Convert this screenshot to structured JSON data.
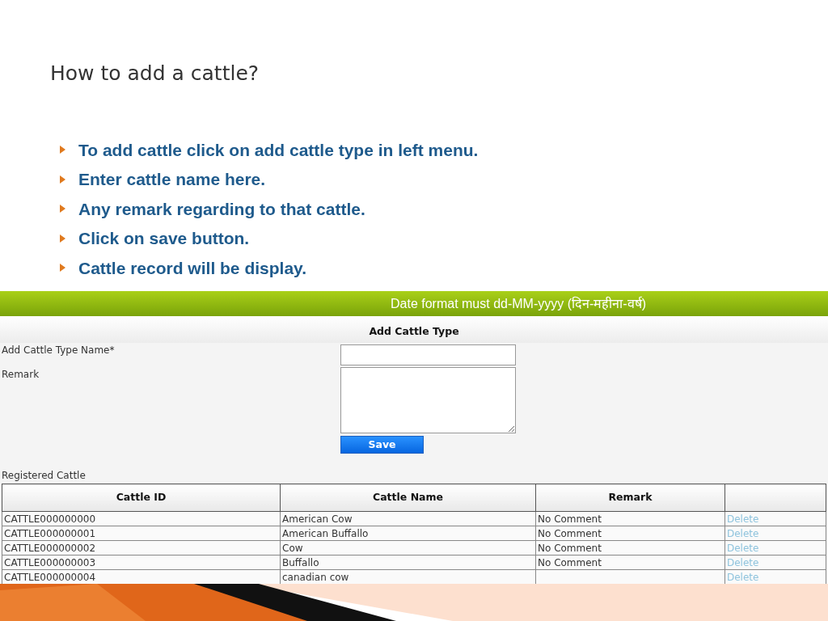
{
  "slide_title": "How to add a cattle?",
  "bullets": [
    "To add cattle click on add cattle type in left menu.",
    "Enter cattle name here.",
    "Any remark regarding to that cattle.",
    "Click on save button.",
    "Cattle record will be display."
  ],
  "app": {
    "banner": "Date format must dd-MM-yyyy (दिन-महीना-वर्ष)",
    "form_title": "Add Cattle Type",
    "fields": [
      {
        "kind": "input",
        "label": "Add Cattle Type Name*"
      },
      {
        "kind": "textarea",
        "label": "Remark"
      }
    ],
    "save_button": "Save",
    "table_caption": "Registered Cattle",
    "table": {
      "columns": [
        "Cattle ID",
        "Cattle Name",
        "Remark"
      ],
      "rows": [
        {
          "id": "CATTLE000000000",
          "name": "American Cow",
          "remark": "No Comment",
          "action": "Delete"
        },
        {
          "id": "CATTLE000000001",
          "name": "American Buffallo",
          "remark": "No Comment",
          "action": "Delete"
        },
        {
          "id": "CATTLE000000002",
          "name": "Cow",
          "remark": "No Comment",
          "action": "Delete"
        },
        {
          "id": "CATTLE000000003",
          "name": "Buffallo",
          "remark": "No Comment",
          "action": "Delete"
        },
        {
          "id": "CATTLE000000004",
          "name": "canadian cow",
          "action": "Delete"
        }
      ]
    }
  }
}
